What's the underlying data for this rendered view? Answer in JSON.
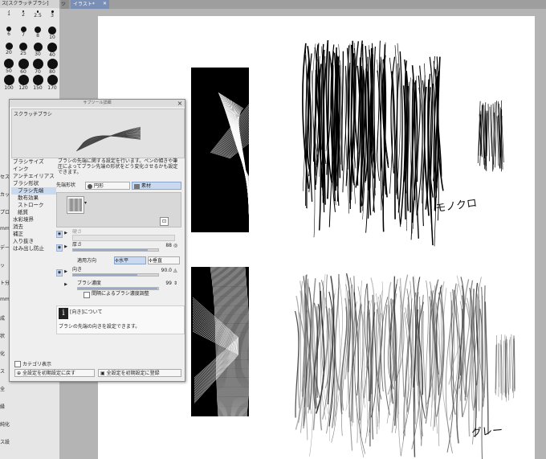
{
  "brush_panel": {
    "title": "ス[スクラッチブラシ]",
    "sizes": [
      "1",
      "2",
      "2.5",
      "3",
      "6",
      "7",
      "8",
      "10",
      "20",
      "25",
      "30",
      "40",
      "50",
      "60",
      "70",
      "80",
      "100",
      "120",
      "150",
      "170"
    ],
    "side_labels": [
      "セス",
      "カッ",
      "プロ選",
      "mm",
      "デー",
      "ッ",
      "ト分:",
      "mm",
      "成",
      "状",
      "化",
      "ス",
      "全",
      "縁",
      "純化",
      "ス設定"
    ]
  },
  "tabs": {
    "active": "イラスト*",
    "prev": "ツ"
  },
  "dialog": {
    "title": "サブツール詳細",
    "close": "×",
    "preview_name": "スクラッチブラシ",
    "categories": [
      {
        "label": "ブラシサイズ",
        "sub": false,
        "selected": false
      },
      {
        "label": "インク",
        "sub": false,
        "selected": false
      },
      {
        "label": "アンチエイリアス",
        "sub": false,
        "selected": false
      },
      {
        "label": "ブラシ形状",
        "sub": false,
        "selected": false
      },
      {
        "label": "ブラシ先端",
        "sub": true,
        "selected": true
      },
      {
        "label": "散布効果",
        "sub": true,
        "selected": false
      },
      {
        "label": "ストローク",
        "sub": true,
        "selected": false
      },
      {
        "label": "紙質",
        "sub": true,
        "selected": false
      },
      {
        "label": "水彩境界",
        "sub": false,
        "selected": false
      },
      {
        "label": "消去",
        "sub": false,
        "selected": false
      },
      {
        "label": "補正",
        "sub": false,
        "selected": false
      },
      {
        "label": "入り抜き",
        "sub": false,
        "selected": false
      },
      {
        "label": "はみ出し防止",
        "sub": false,
        "selected": false
      }
    ],
    "description": "ブラシの先端に関する設定を行います。ペンの傾きや筆圧によってブラシ先端の形状をどう変化させるかも設定できます。",
    "tip_shape_label": "先端形状",
    "tip_circle": "円形",
    "tip_material": "素材",
    "thickness_label": "硬さ",
    "width_label": "厚さ",
    "width_value": "88",
    "direction_label": "適用方向",
    "horizontal": "水平",
    "vertical": "垂直",
    "angle_label": "向き",
    "angle_value": "90.0",
    "density_label": "ブラシ濃度",
    "density_value": "99",
    "density_check": "間隔によるブラシ濃度調整",
    "info_title": "[向き]について",
    "info_body": "ブラシの先端の向きを設定できます。",
    "show_category": "カテゴリ表示",
    "reset_all": "全設定を初期設定に戻す",
    "register_all": "全設定を初期設定に登録"
  },
  "annotations": {
    "mono": "モノクロ",
    "gray": "グレー"
  },
  "colors": {
    "accent": "#c9daf0",
    "tab_active": "#7a8fb5",
    "ink": "#111111"
  }
}
